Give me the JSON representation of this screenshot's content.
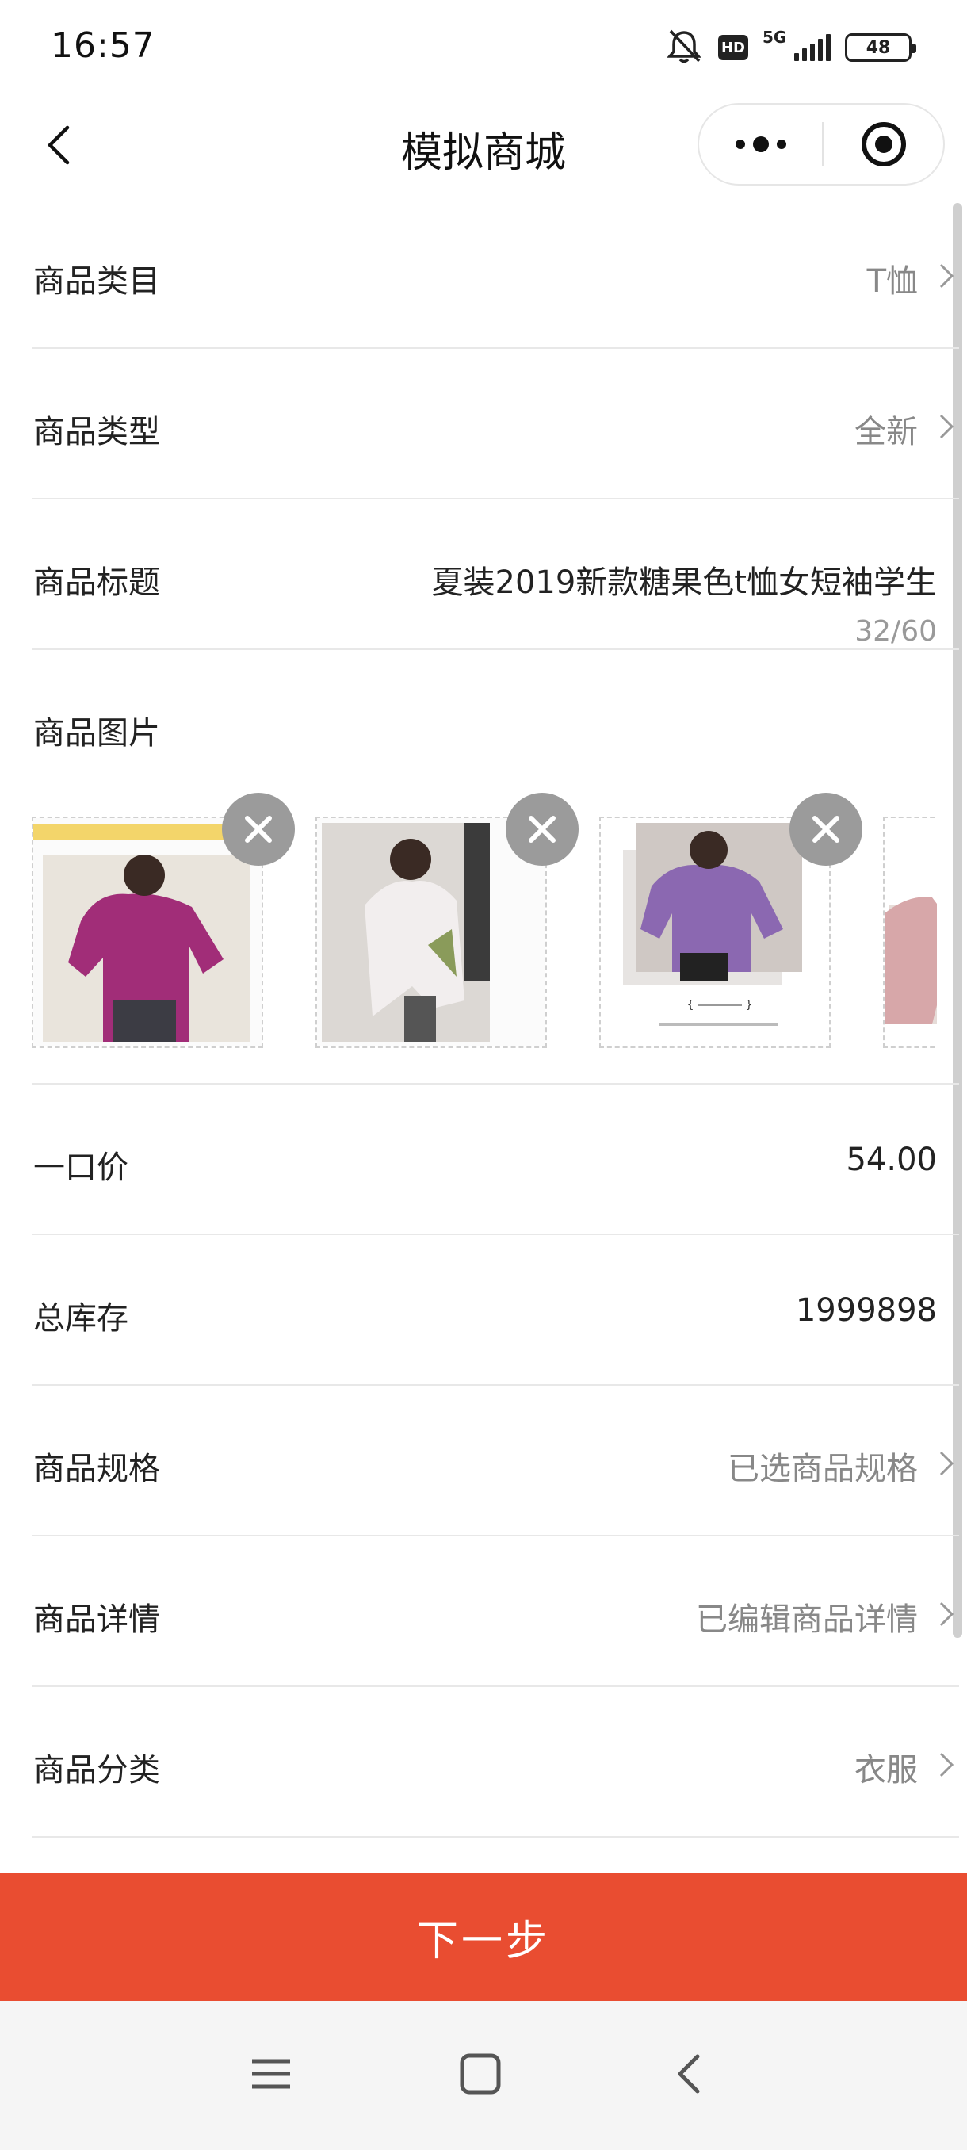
{
  "status_bar": {
    "time": "16:57",
    "network": "5G",
    "hd_label": "HD",
    "battery": "48"
  },
  "nav": {
    "title": "模拟商城"
  },
  "form": {
    "category": {
      "label": "商品类目",
      "value": "T恤"
    },
    "type": {
      "label": "商品类型",
      "value": "全新"
    },
    "title": {
      "label": "商品标题",
      "value": "夏装2019新款糖果色t恤女短袖学生",
      "counter": "32/60"
    },
    "images": {
      "label": "商品图片"
    },
    "price": {
      "label": "一口价",
      "value": "54.00"
    },
    "stock": {
      "label": "总库存",
      "value": "1999898"
    },
    "spec": {
      "label": "商品规格",
      "value": "已选商品规格"
    },
    "detail": {
      "label": "商品详情",
      "value": "已编辑商品详情"
    },
    "classification": {
      "label": "商品分类",
      "value": "衣服"
    }
  },
  "actions": {
    "next_label": "下一步"
  },
  "colors": {
    "primary": "#e94d31",
    "text_muted": "#888888",
    "divider": "#e8e8e8"
  }
}
